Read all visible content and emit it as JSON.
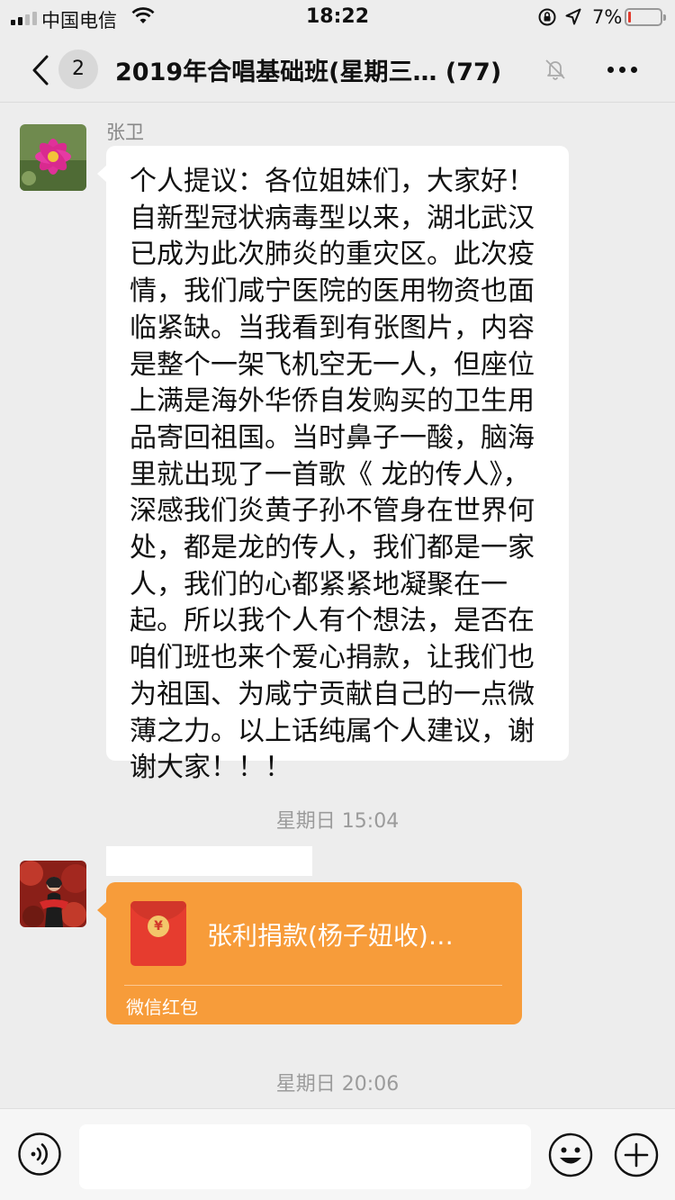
{
  "status_bar": {
    "carrier": "中国电信",
    "time": "18:22",
    "battery_percent": "7%",
    "battery_level": 0.07,
    "icons": [
      "signal-icon",
      "wifi-icon",
      "rotation-lock-icon",
      "location-icon",
      "battery-icon"
    ]
  },
  "nav": {
    "unread_count": "2",
    "title": "2019年合唱基础班(星期三…",
    "member_count": "(77)",
    "icons": [
      "back-icon",
      "mute-icon",
      "more-icon"
    ]
  },
  "messages": [
    {
      "sender": "张卫",
      "lines": [
        "个人提议：各位姐妹们，大家好！",
        "自新型冠状病毒型以来，湖北武汉",
        "已成为此次肺炎的重灾区。此次疫",
        "情，我们咸宁医院的医用物资也面",
        "临紧缺。当我看到有张图片，内容",
        "是整个一架飞机空无一人，但座位",
        "上满是海外华侨自发购买的卫生用",
        "品寄回祖国。当时鼻子一酸，脑海",
        "里就出现了一首歌《 龙的传人》，",
        "深感我们炎黄子孙不管身在世界何",
        "处，都是龙的传人，我们都是一家",
        "人，我们的心都紧紧地凝聚在一",
        "起。所以我个人有个想法，是否在",
        "咱们班也来个爱心捐款，让我们也",
        "为祖国、为咸宁贡献自己的一点微",
        "薄之力。以上话纯属个人建议，谢",
        "谢大家！！！"
      ]
    }
  ],
  "time_separators": [
    "星期日 15:04",
    "星期日 20:06"
  ],
  "red_packet": {
    "title": "张利捐款(杨子妞收)…",
    "footer": "微信红包",
    "coin_symbol": "¥"
  },
  "input_bar": {
    "placeholder": "",
    "icons": [
      "voice-icon",
      "emoji-icon",
      "plus-icon"
    ]
  },
  "colors": {
    "background": "#ededed",
    "bubble": "#ffffff",
    "red_packet": "#f79c3a",
    "battery_low": "#e23b2e"
  }
}
